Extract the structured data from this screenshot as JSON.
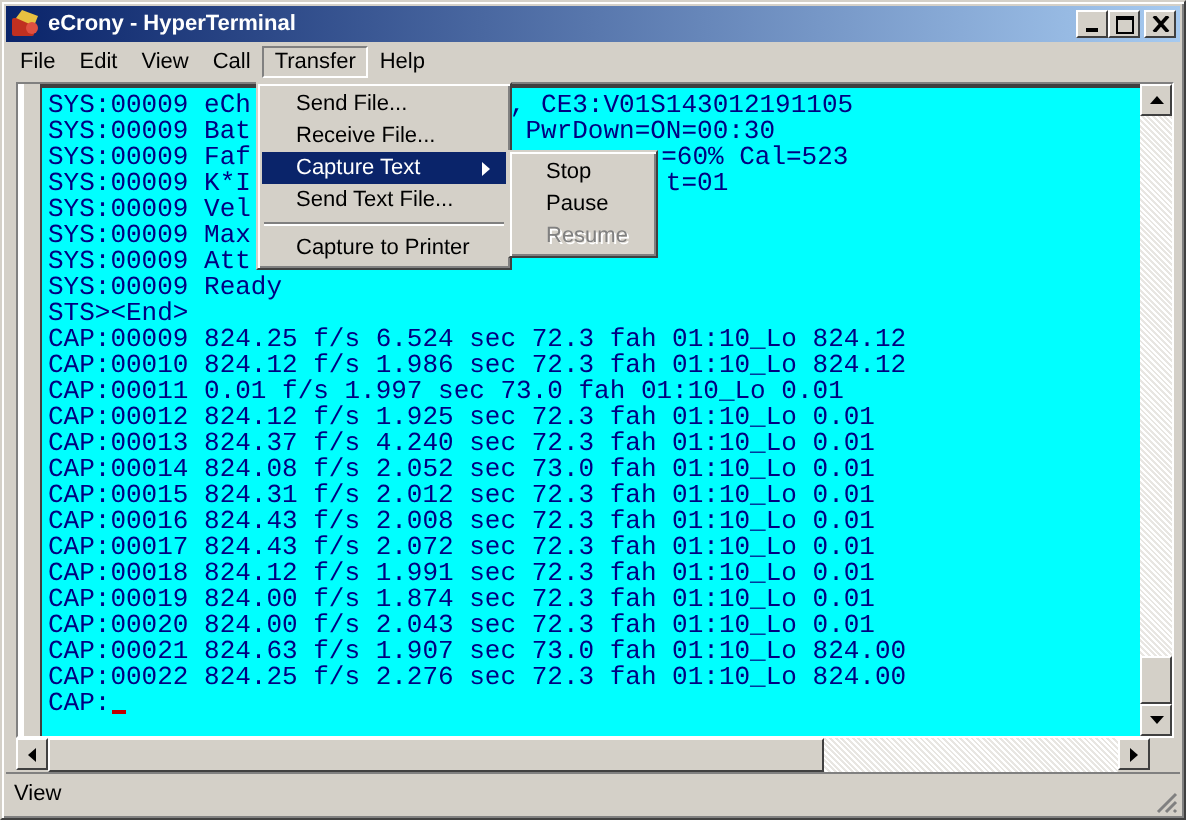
{
  "window": {
    "title": "eCrony - HyperTerminal"
  },
  "menu_bar": [
    {
      "label": "File",
      "selected": false
    },
    {
      "label": "Edit",
      "selected": false
    },
    {
      "label": "View",
      "selected": false
    },
    {
      "label": "Call",
      "selected": false
    },
    {
      "label": "Transfer",
      "selected": true
    },
    {
      "label": "Help",
      "selected": false
    }
  ],
  "transfer_menu": [
    {
      "kind": "item",
      "label": "Send File...",
      "highlighted": false,
      "has_submenu": false
    },
    {
      "kind": "item",
      "label": "Receive File...",
      "highlighted": false,
      "has_submenu": false
    },
    {
      "kind": "item",
      "label": "Capture Text",
      "highlighted": true,
      "has_submenu": true
    },
    {
      "kind": "item",
      "label": "Send Text File...",
      "highlighted": false,
      "has_submenu": false
    },
    {
      "kind": "separator"
    },
    {
      "kind": "item",
      "label": "Capture to Printer",
      "highlighted": false,
      "has_submenu": false
    }
  ],
  "capture_submenu": [
    {
      "label": "Stop",
      "disabled": false
    },
    {
      "label": "Pause",
      "disabled": false
    },
    {
      "label": "Resume",
      "disabled": true
    }
  ],
  "terminal": {
    "lines": [
      {
        "text": "SYS:00009 eCh",
        "text_2": ", CE3:V01S143012191105"
      },
      {
        "text": "SYS:00009 Bat",
        "text_2": "PwrDown=ON=00:30"
      },
      {
        "text": "SYS:00009 Faf",
        "text_2": "=60% Cal=523"
      },
      {
        "text": "SYS:00009 K*I",
        "text_2": "t=01"
      },
      {
        "text": "SYS:00009 Vel"
      },
      {
        "text": "SYS:00009 Max"
      },
      {
        "text": "SYS:00009 Att"
      },
      {
        "text": "SYS:00009 Ready"
      },
      {
        "text": "STS><End>"
      },
      {
        "text": "CAP:00009 824.25 f/s 6.524 sec 72.3 fah 01:10_Lo 824.12"
      },
      {
        "text": "CAP:00010 824.12 f/s 1.986 sec 72.3 fah 01:10_Lo 824.12"
      },
      {
        "text": "CAP:00011 0.01 f/s 1.997 sec 73.0 fah 01:10_Lo 0.01"
      },
      {
        "text": "CAP:00012 824.12 f/s 1.925 sec 72.3 fah 01:10_Lo 0.01"
      },
      {
        "text": "CAP:00013 824.37 f/s 4.240 sec 72.3 fah 01:10_Lo 0.01"
      },
      {
        "text": "CAP:00014 824.08 f/s 2.052 sec 73.0 fah 01:10_Lo 0.01"
      },
      {
        "text": "CAP:00015 824.31 f/s 2.012 sec 72.3 fah 01:10_Lo 0.01"
      },
      {
        "text": "CAP:00016 824.43 f/s 2.008 sec 72.3 fah 01:10_Lo 0.01"
      },
      {
        "text": "CAP:00017 824.43 f/s 2.072 sec 72.3 fah 01:10_Lo 0.01"
      },
      {
        "text": "CAP:00018 824.12 f/s 1.991 sec 72.3 fah 01:10_Lo 0.01"
      },
      {
        "text": "CAP:00019 824.00 f/s 1.874 sec 72.3 fah 01:10_Lo 0.01"
      },
      {
        "text": "CAP:00020 824.00 f/s 2.043 sec 72.3 fah 01:10_Lo 0.01"
      },
      {
        "text": "CAP:00021 824.63 f/s 1.907 sec 73.0 fah 01:10_Lo 824.00"
      },
      {
        "text": "CAP:00022 824.25 f/s 2.276 sec 72.3 fah 01:10_Lo 824.00"
      },
      {
        "text": "CAP:",
        "cursor": true
      }
    ]
  },
  "status_bar": {
    "text": "View"
  }
}
